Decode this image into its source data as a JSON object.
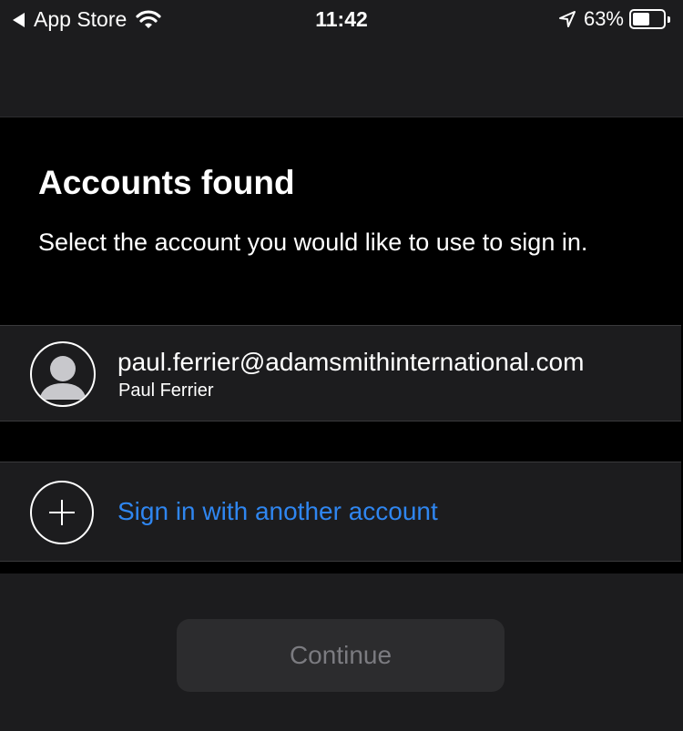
{
  "status_bar": {
    "back_label": "App Store",
    "time": "11:42",
    "battery_text": "63%",
    "battery_level": 0.63,
    "icons": [
      "back-arrow-icon",
      "wifi-icon",
      "location-arrow-icon",
      "battery-icon"
    ]
  },
  "page": {
    "title": "Accounts found",
    "subtitle": "Select the account you would like to use to sign in."
  },
  "account": {
    "email": "paul.ferrier@adamsmithinternational.com",
    "name": "Paul Ferrier",
    "icon": "avatar-icon"
  },
  "other_account": {
    "label": "Sign in with another account",
    "icon": "plus-circle-icon",
    "color": "#2f86f0"
  },
  "footer": {
    "continue_label": "Continue",
    "continue_enabled": false
  }
}
